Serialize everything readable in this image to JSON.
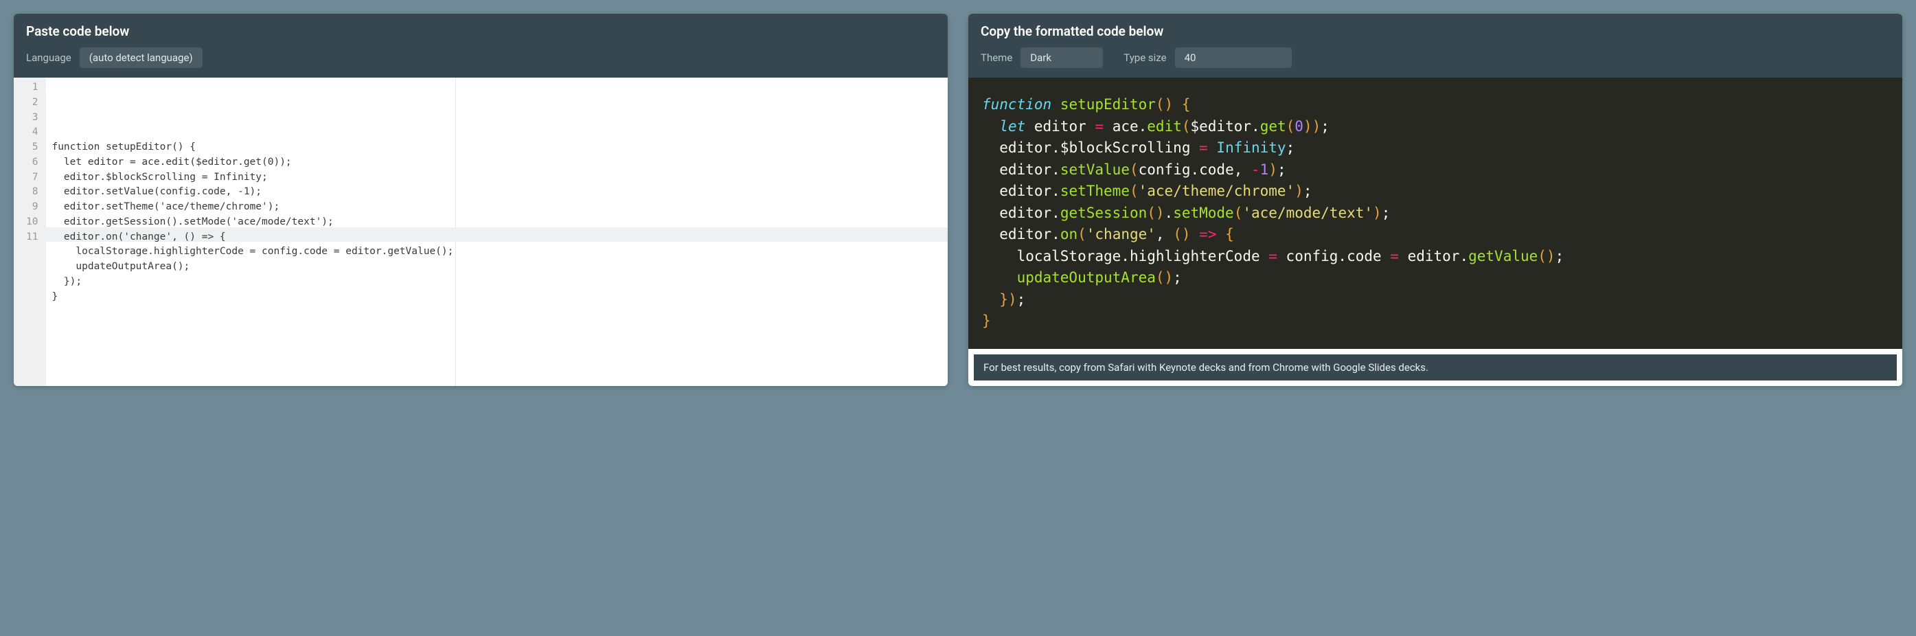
{
  "left": {
    "title": "Paste code below",
    "language_label": "Language",
    "language_value": "(auto detect language)",
    "line_numbers": [
      "1",
      "2",
      "3",
      "4",
      "5",
      "6",
      "7",
      "8",
      "9",
      "10",
      "11"
    ],
    "highlight_row_index": 10,
    "code_lines": [
      "function setupEditor() {",
      "  let editor = ace.edit($editor.get(0));",
      "  editor.$blockScrolling = Infinity;",
      "  editor.setValue(config.code, -1);",
      "  editor.setTheme('ace/theme/chrome');",
      "  editor.getSession().setMode('ace/mode/text');",
      "  editor.on('change', () => {",
      "    localStorage.highlighterCode = config.code = editor.getValue();",
      "    updateOutputArea();",
      "  });",
      "}"
    ]
  },
  "right": {
    "title": "Copy the formatted code below",
    "theme_label": "Theme",
    "theme_value": "Dark",
    "size_label": "Type size",
    "size_value": "40",
    "tip": "For best results, copy from Safari with Keynote decks and from Chrome with Google Slides decks."
  },
  "tokens": [
    [
      [
        "function",
        "kw"
      ],
      [
        " ",
        "id"
      ],
      [
        "setupEditor",
        "fn"
      ],
      [
        "()",
        "p"
      ],
      [
        " ",
        "id"
      ],
      [
        "{",
        "p"
      ]
    ],
    [
      [
        "  ",
        "id"
      ],
      [
        "let",
        "decl"
      ],
      [
        " editor ",
        "id"
      ],
      [
        "=",
        "op"
      ],
      [
        " ace",
        "id"
      ],
      [
        ".",
        "id"
      ],
      [
        "edit",
        "fn"
      ],
      [
        "(",
        "p"
      ],
      [
        "$editor",
        "id"
      ],
      [
        ".",
        "id"
      ],
      [
        "get",
        "fn"
      ],
      [
        "(",
        "p"
      ],
      [
        "0",
        "num"
      ],
      [
        "))",
        "p"
      ],
      [
        ";",
        "id"
      ]
    ],
    [
      [
        "  editor",
        "id"
      ],
      [
        ".",
        "id"
      ],
      [
        "$blockScrolling ",
        "id"
      ],
      [
        "=",
        "op"
      ],
      [
        " ",
        "id"
      ],
      [
        "Infinity",
        "const"
      ],
      [
        ";",
        "id"
      ]
    ],
    [
      [
        "  editor",
        "id"
      ],
      [
        ".",
        "id"
      ],
      [
        "setValue",
        "fn"
      ],
      [
        "(",
        "p"
      ],
      [
        "config",
        "id"
      ],
      [
        ".",
        "id"
      ],
      [
        "code",
        "id"
      ],
      [
        ", ",
        "id"
      ],
      [
        "-",
        "op"
      ],
      [
        "1",
        "num"
      ],
      [
        ")",
        "p"
      ],
      [
        ";",
        "id"
      ]
    ],
    [
      [
        "  editor",
        "id"
      ],
      [
        ".",
        "id"
      ],
      [
        "setTheme",
        "fn"
      ],
      [
        "(",
        "p"
      ],
      [
        "'ace/theme/chrome'",
        "str"
      ],
      [
        ")",
        "p"
      ],
      [
        ";",
        "id"
      ]
    ],
    [
      [
        "  editor",
        "id"
      ],
      [
        ".",
        "id"
      ],
      [
        "getSession",
        "fn"
      ],
      [
        "()",
        "p"
      ],
      [
        ".",
        "id"
      ],
      [
        "setMode",
        "fn"
      ],
      [
        "(",
        "p"
      ],
      [
        "'ace/mode/text'",
        "str"
      ],
      [
        ")",
        "p"
      ],
      [
        ";",
        "id"
      ]
    ],
    [
      [
        "  editor",
        "id"
      ],
      [
        ".",
        "id"
      ],
      [
        "on",
        "fn"
      ],
      [
        "(",
        "p"
      ],
      [
        "'change'",
        "str"
      ],
      [
        ", ",
        "id"
      ],
      [
        "()",
        "p"
      ],
      [
        " ",
        "id"
      ],
      [
        "=>",
        "op"
      ],
      [
        " ",
        "id"
      ],
      [
        "{",
        "p"
      ]
    ],
    [
      [
        "    localStorage",
        "id"
      ],
      [
        ".",
        "id"
      ],
      [
        "highlighterCode ",
        "id"
      ],
      [
        "=",
        "op"
      ],
      [
        " config",
        "id"
      ],
      [
        ".",
        "id"
      ],
      [
        "code ",
        "id"
      ],
      [
        "=",
        "op"
      ],
      [
        " editor",
        "id"
      ],
      [
        ".",
        "id"
      ],
      [
        "getValue",
        "fn"
      ],
      [
        "()",
        "p"
      ],
      [
        ";",
        "id"
      ]
    ],
    [
      [
        "    ",
        "id"
      ],
      [
        "updateOutputArea",
        "fn"
      ],
      [
        "()",
        "p"
      ],
      [
        ";",
        "id"
      ]
    ],
    [
      [
        "  ",
        "id"
      ],
      [
        "})",
        "p"
      ],
      [
        ";",
        "id"
      ]
    ],
    [
      [
        "}",
        "p"
      ]
    ]
  ]
}
